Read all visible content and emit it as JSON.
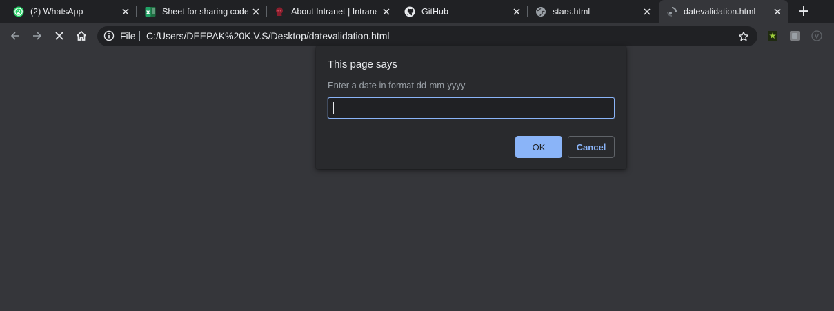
{
  "tabs": [
    {
      "title": "(2) WhatsApp",
      "icon": "whatsapp-icon",
      "active": false
    },
    {
      "title": "Sheet for sharing code links",
      "icon": "excel-icon",
      "active": false
    },
    {
      "title": "About Intranet | Intranet",
      "icon": "intranet-logo-icon",
      "active": false
    },
    {
      "title": "GitHub",
      "icon": "github-icon",
      "active": false
    },
    {
      "title": "stars.html",
      "icon": "globe-icon",
      "active": false
    },
    {
      "title": "datevalidation.html",
      "icon": "loading-spinner-icon",
      "active": true
    }
  ],
  "new_tab_label": "+",
  "toolbar": {
    "scheme_label": "File",
    "url": "C:/Users/DEEPAK%20K.V.S/Desktop/datevalidation.html"
  },
  "dialog": {
    "title": "This page says",
    "message": "Enter a date in format dd-mm-yyyy",
    "input_value": "",
    "ok_label": "OK",
    "cancel_label": "Cancel"
  },
  "colors": {
    "tabstrip_bg": "#202124",
    "toolbar_bg": "#35363a",
    "dialog_bg": "#292a2d",
    "accent": "#8ab4f8",
    "text": "#e8eaed",
    "muted_text": "#9aa0a6"
  }
}
